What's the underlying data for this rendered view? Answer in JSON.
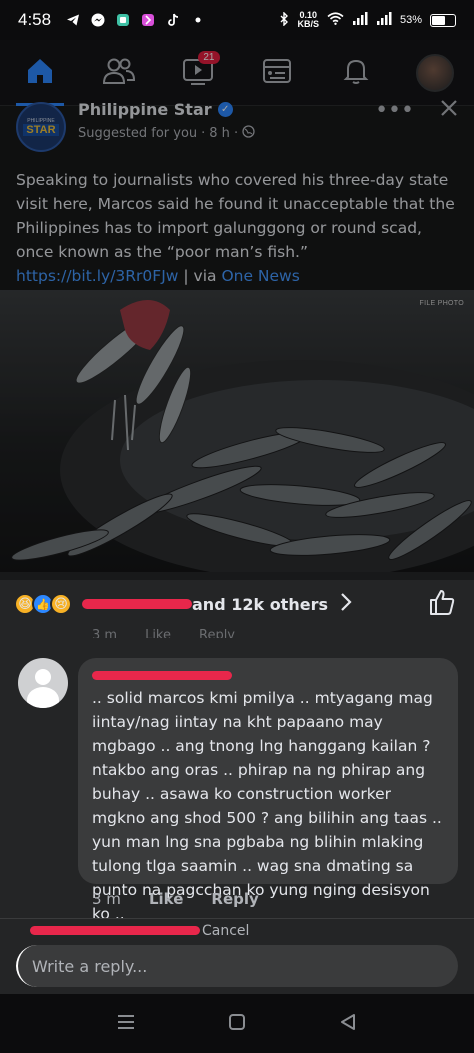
{
  "status_bar": {
    "time": "4:58",
    "net_speed": "0.10",
    "net_unit": "KB/S",
    "battery": "53",
    "battery_level": 0.53
  },
  "nav": {
    "video_badge": "21"
  },
  "post": {
    "page_name": "Philippine Star",
    "logo_small": "PHILIPPINE",
    "logo_big": "STAR",
    "subtitle": "Suggested for you",
    "time": "8 h",
    "caption_text": "Speaking to journalists who covered his three-day state visit here, Marcos said he found it unacceptable that the Philippines has to import galunggong or round scad, once known as the “poor man’s fish.” ",
    "caption_link": "https://bit.ly/3Rr0FJw",
    "caption_via": " | via ",
    "caption_source": "One News",
    "photo_credit": "FILE PHOTO"
  },
  "reactions": {
    "suffix": "and 12k others"
  },
  "prev_comment_meta": {
    "time": "3 m",
    "like": "Like",
    "reply": "Reply"
  },
  "comment": {
    "text": ".. solid marcos kmi pmilya .. mtyagang mag iintay/nag iintay na kht papaano may mgbago .. ang tnong lng hanggang kailan ? ntakbo ang oras .. phirap na ng phirap ang buhay .. asawa ko construction worker mgkno ang shod 500 ? ang bilihin ang taas .. yun man lng sna pgbaba ng blihin mlaking tulong tlga saamin .. wag sna dmating sa punto na pagcchan ko yung nging desisyon ko ..",
    "time": "3 m",
    "like": "Like",
    "reply": "Reply"
  },
  "reply_bar": {
    "cancel": "Cancel",
    "placeholder": "Write a reply..."
  }
}
